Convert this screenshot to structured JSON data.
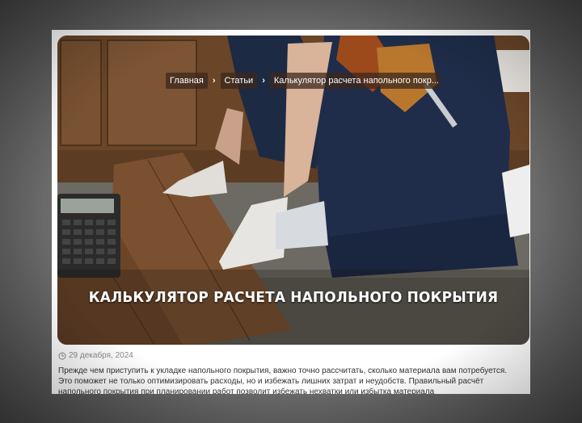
{
  "breadcrumb": {
    "home": "Главная",
    "section": "Статьи",
    "current": "Калькулятор расчета напольного покр..."
  },
  "article": {
    "title": "КАЛЬКУЛЯТОР РАСЧЕТА НАПОЛЬНОГО ПОКРЫТИЯ",
    "date": "29 декабря, 2024",
    "intro_lines": [
      "Прежде чем приступить к укладке напольного покрытия, важно точно рассчитать, сколько материала вам потребуется.",
      "Это поможет не только оптимизировать расходы, но и избежать лишних затрат и неудобств. Правильный расчёт",
      "напольного покрытия при планировании работ позволит избежать нехватки или избытка материала"
    ]
  },
  "icons": {
    "breadcrumb_separator": "chevron-right-icon",
    "date": "clock-icon"
  }
}
